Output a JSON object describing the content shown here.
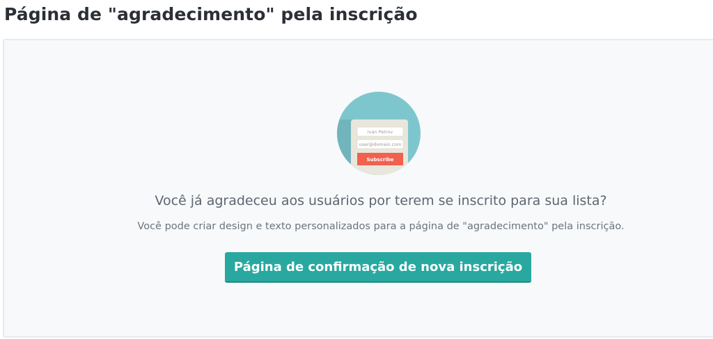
{
  "page": {
    "title": "Página de \"agradecimento\" pela inscrição"
  },
  "illustration": {
    "name_placeholder": "Ivan Petrov",
    "email_placeholder": "user@domain.com",
    "subscribe_label": "Subscribe"
  },
  "content": {
    "headline": "Você já agradeceu aos usuários por terem se inscrito para sua lista?",
    "subline": "Você pode criar design e texto personalizados para a página de \"agradecimento\" pela inscrição.",
    "cta_label": "Página de confirmação de nova inscrição"
  },
  "colors": {
    "accent": "#29a8a0",
    "circle": "#7ec6ce",
    "subscribe": "#f0614f"
  }
}
